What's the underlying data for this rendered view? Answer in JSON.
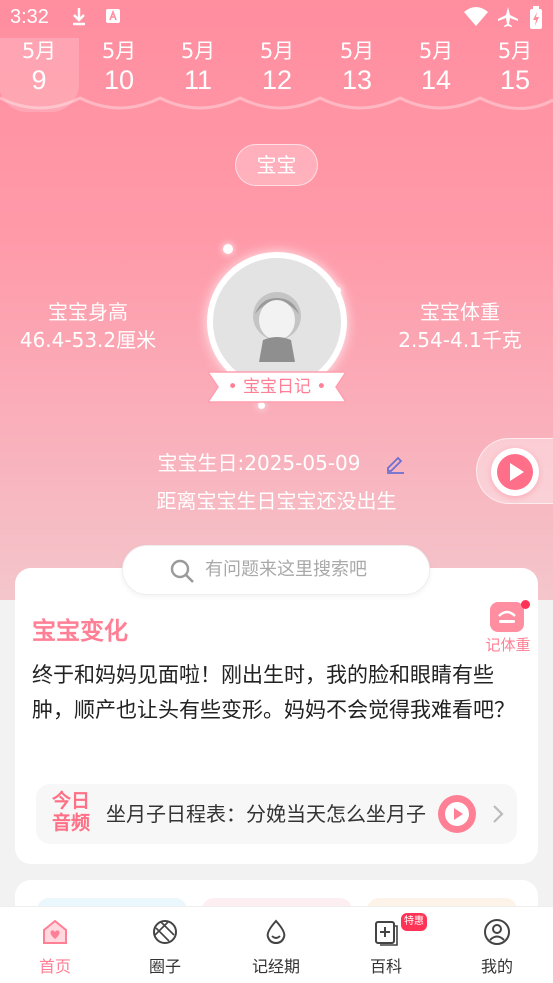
{
  "status_bar": {
    "time": "3:32"
  },
  "date_strip": {
    "dates": [
      {
        "month": "5月",
        "day": "9",
        "selected": true
      },
      {
        "month": "5月",
        "day": "10"
      },
      {
        "month": "5月",
        "day": "11"
      },
      {
        "month": "5月",
        "day": "12"
      },
      {
        "month": "5月",
        "day": "13"
      },
      {
        "month": "5月",
        "day": "14"
      },
      {
        "month": "5月",
        "day": "15"
      }
    ]
  },
  "baby_tag": "宝宝",
  "height": {
    "label": "宝宝身高",
    "value": "46.4-53.2厘米"
  },
  "weight": {
    "label": "宝宝体重",
    "value": "2.54-4.1千克"
  },
  "diary_label": "• 宝宝日记 •",
  "birthday": {
    "text": "宝宝生日:2025-05-09"
  },
  "countdown": "距离宝宝生日宝宝还没出生",
  "search": {
    "placeholder": "有问题来这里搜索吧"
  },
  "card": {
    "title": "宝宝变化",
    "record_weight_label": "记体重",
    "body": "终于和妈妈见面啦！刚出生时，我的脸和眼睛有些肿，顺产也让头有些变形。妈妈不会觉得我难看吧？",
    "audio": {
      "badge_line1": "今日",
      "badge_line2": "音频",
      "title": "坐月子日程表：分娩当天怎么坐月子"
    }
  },
  "bottom_nav": {
    "items": [
      {
        "label": "首页",
        "active": true
      },
      {
        "label": "圈子"
      },
      {
        "label": "记经期"
      },
      {
        "label": "百科"
      },
      {
        "label": "我的"
      }
    ],
    "hot_badge": "特惠"
  },
  "colors": {
    "accent": "#ff7f95",
    "hero_top": "#ff8e9f",
    "badge_red": "#ff3355"
  }
}
